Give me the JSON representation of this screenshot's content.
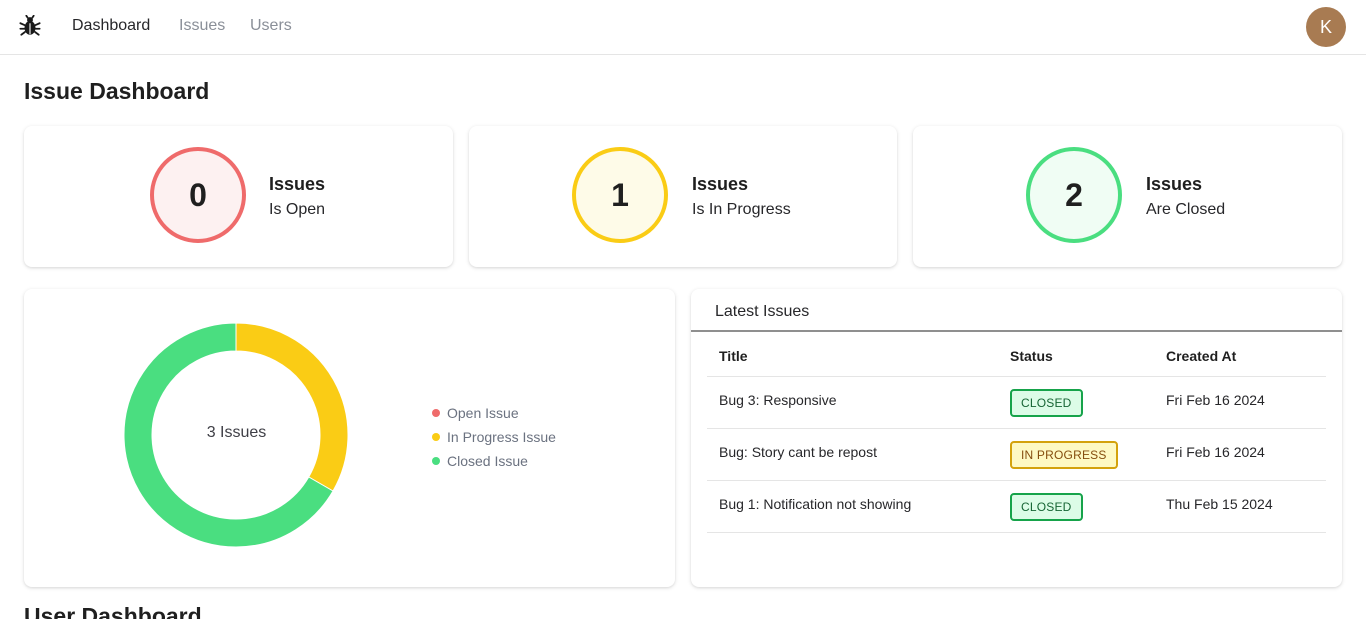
{
  "nav": {
    "items": [
      {
        "label": "Dashboard",
        "active": true
      },
      {
        "label": "Issues",
        "active": false
      },
      {
        "label": "Users",
        "active": false
      }
    ],
    "avatar_initial": "K",
    "logo_icon": "bug-icon"
  },
  "page_title": "Issue Dashboard",
  "stats": [
    {
      "count": "0",
      "title": "Issues",
      "subtitle": "Is Open",
      "color": "#ef6b6b",
      "bg": "#fdf1f1"
    },
    {
      "count": "1",
      "title": "Issues",
      "subtitle": "Is In Progress",
      "color": "#facc15",
      "bg": "#fefbe8"
    },
    {
      "count": "2",
      "title": "Issues",
      "subtitle": "Are Closed",
      "color": "#4ade80",
      "bg": "#f0fdf4"
    }
  ],
  "chart_data": {
    "type": "pie",
    "categories": [
      "Open Issue",
      "In Progress Issue",
      "Closed Issue"
    ],
    "values": [
      0,
      1,
      2
    ],
    "colors": [
      "#ef6b6b",
      "#facc15",
      "#4ade80"
    ],
    "center_label": "3 Issues",
    "legend_position": "right"
  },
  "latest": {
    "title": "Latest Issues",
    "columns": [
      "Title",
      "Status",
      "Created At"
    ],
    "rows": [
      {
        "title": "Bug 3: Responsive",
        "status": "CLOSED",
        "created": "Fri Feb 16 2024"
      },
      {
        "title": "Bug: Story cant be repost",
        "status": "IN PROGRESS",
        "created": "Fri Feb 16 2024"
      },
      {
        "title": "Bug 1: Notification not showing",
        "status": "CLOSED",
        "created": "Thu Feb 15 2024"
      }
    ],
    "status_colors": {
      "CLOSED": {
        "border": "#16a34a",
        "bg": "#dcfce7",
        "text": "#166534"
      },
      "IN PROGRESS": {
        "border": "#d4a20c",
        "bg": "#fef9c3",
        "text": "#854d0e"
      }
    }
  },
  "user_section_title": "User Dashboard"
}
